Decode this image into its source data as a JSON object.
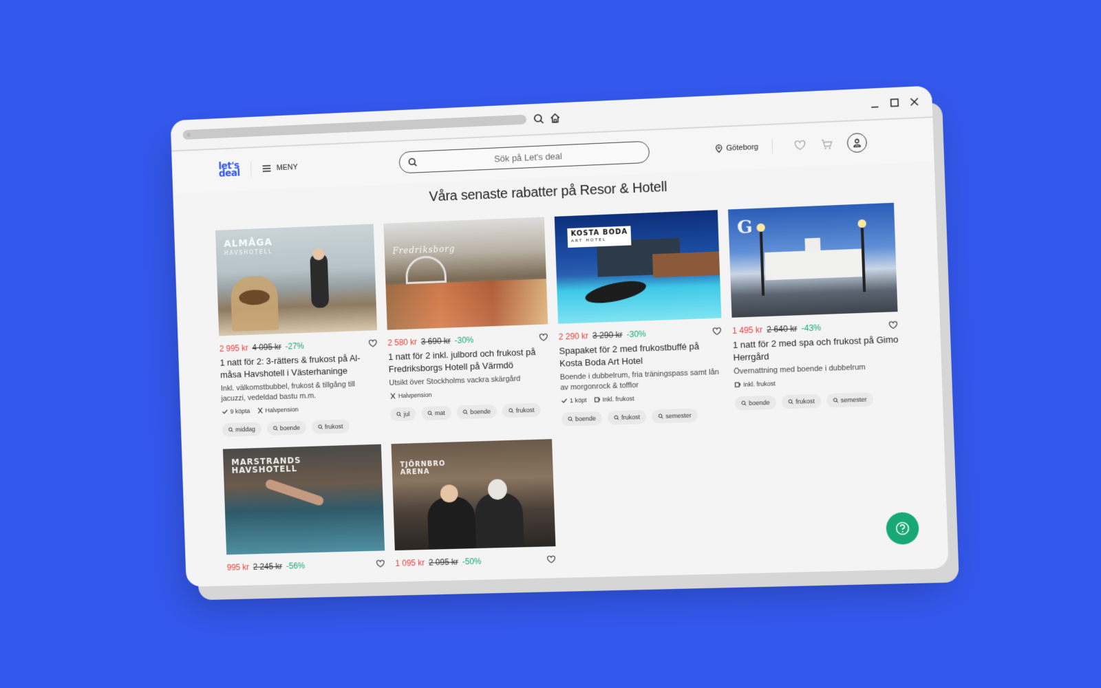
{
  "browser": {
    "tune_icon": "sliders-icon"
  },
  "header": {
    "logo_line1": "let's",
    "logo_line2": "deal",
    "menu_label": "MENY",
    "search_placeholder": "Sök på Let's deal",
    "location": "Göteborg"
  },
  "page_title": "Våra senaste rabatter på Resor & Hotell",
  "deals": [
    {
      "brand": "ALMÅGA",
      "brand_sub": "HAVSHOTELL",
      "price": "2 995 kr",
      "old_price": "4 095 kr",
      "discount": "-27%",
      "title": "1 natt för 2: 3-rätters & frukost på Al-måsa Havshotell i Västerhaninge",
      "desc": "Inkl. välkomstbubbel, frukost & tillgång till jacuzzi, vedeldad bastu m.m.",
      "meta": [
        "9 köpta",
        "Halvpension"
      ],
      "tags": [
        "middag",
        "boende",
        "frukost"
      ]
    },
    {
      "brand": "Fredriksborg",
      "brand_sub": "",
      "price": "2 580 kr",
      "old_price": "3 690 kr",
      "discount": "-30%",
      "title": "1 natt för 2 inkl. julbord och frukost på Fredriksborgs Hotell på Värmdö",
      "desc": "Utsikt över Stockholms vackra skärgård",
      "meta": [
        "Halvpension"
      ],
      "tags": [
        "jul",
        "mat",
        "boende",
        "frukost"
      ]
    },
    {
      "brand": "KOSTA BODA",
      "brand_sub": "ART HOTEL",
      "price": "2 290 kr",
      "old_price": "3 290 kr",
      "discount": "-30%",
      "title": "Spapaket för 2 med frukostbuffé på Kosta Boda Art Hotel",
      "desc": "Boende i dubbelrum, fria träningspass samt lån av morgonrock & tofflor",
      "meta": [
        "1 köpt",
        "Inkl. frukost"
      ],
      "tags": [
        "boende",
        "frukost",
        "semester"
      ]
    },
    {
      "brand": "G",
      "brand_sub": "",
      "price": "1 495 kr",
      "old_price": "2 640 kr",
      "discount": "-43%",
      "title": "1 natt för 2 med spa och frukost på Gimo Herrgård",
      "desc": "Övernattning med boende i dubbelrum",
      "meta": [
        "Inkl. frukost"
      ],
      "tags": [
        "boende",
        "frukost",
        "semester"
      ]
    },
    {
      "brand": "MARSTRANDS",
      "brand_sub": "HAVSHOTELL",
      "price": "995 kr",
      "old_price": "2 245 kr",
      "discount": "-56%"
    },
    {
      "brand": "TJÖRNBRO",
      "brand_sub": "ARENA",
      "price": "1 095 kr",
      "old_price": "2 095 kr",
      "discount": "-50%"
    }
  ],
  "colors": {
    "background": "#3358EF",
    "brand_blue": "#2f57e6",
    "price_red": "#e8413c",
    "discount_green": "#19a87a",
    "help_green": "#17a876"
  }
}
